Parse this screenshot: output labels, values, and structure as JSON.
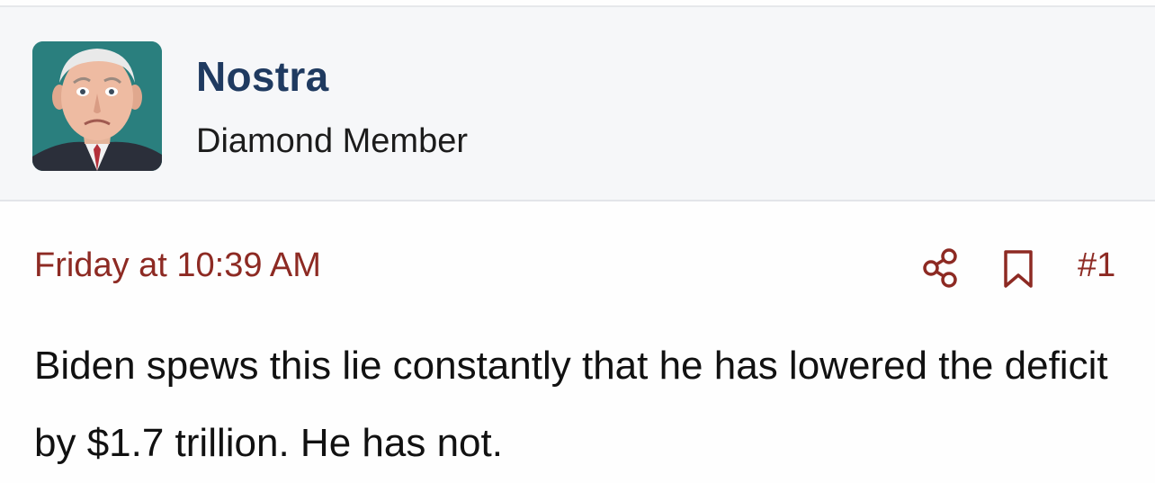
{
  "user": {
    "name": "Nostra",
    "title": "Diamond Member",
    "avatar_icon": "user-photo-avatar"
  },
  "post": {
    "date": "Friday at 10:39 AM",
    "number": "#1",
    "body": "Biden spews this lie constantly that he has lowered the deficit by $1.7 trillion. He has not.",
    "actions": {
      "share_icon": "share-icon",
      "bookmark_icon": "bookmark-icon"
    }
  },
  "colors": {
    "username": "#1f3a60",
    "accent": "#8d2a23",
    "user_block_bg": "#f6f7f9",
    "avatar_bg": "#2a7f7e"
  }
}
